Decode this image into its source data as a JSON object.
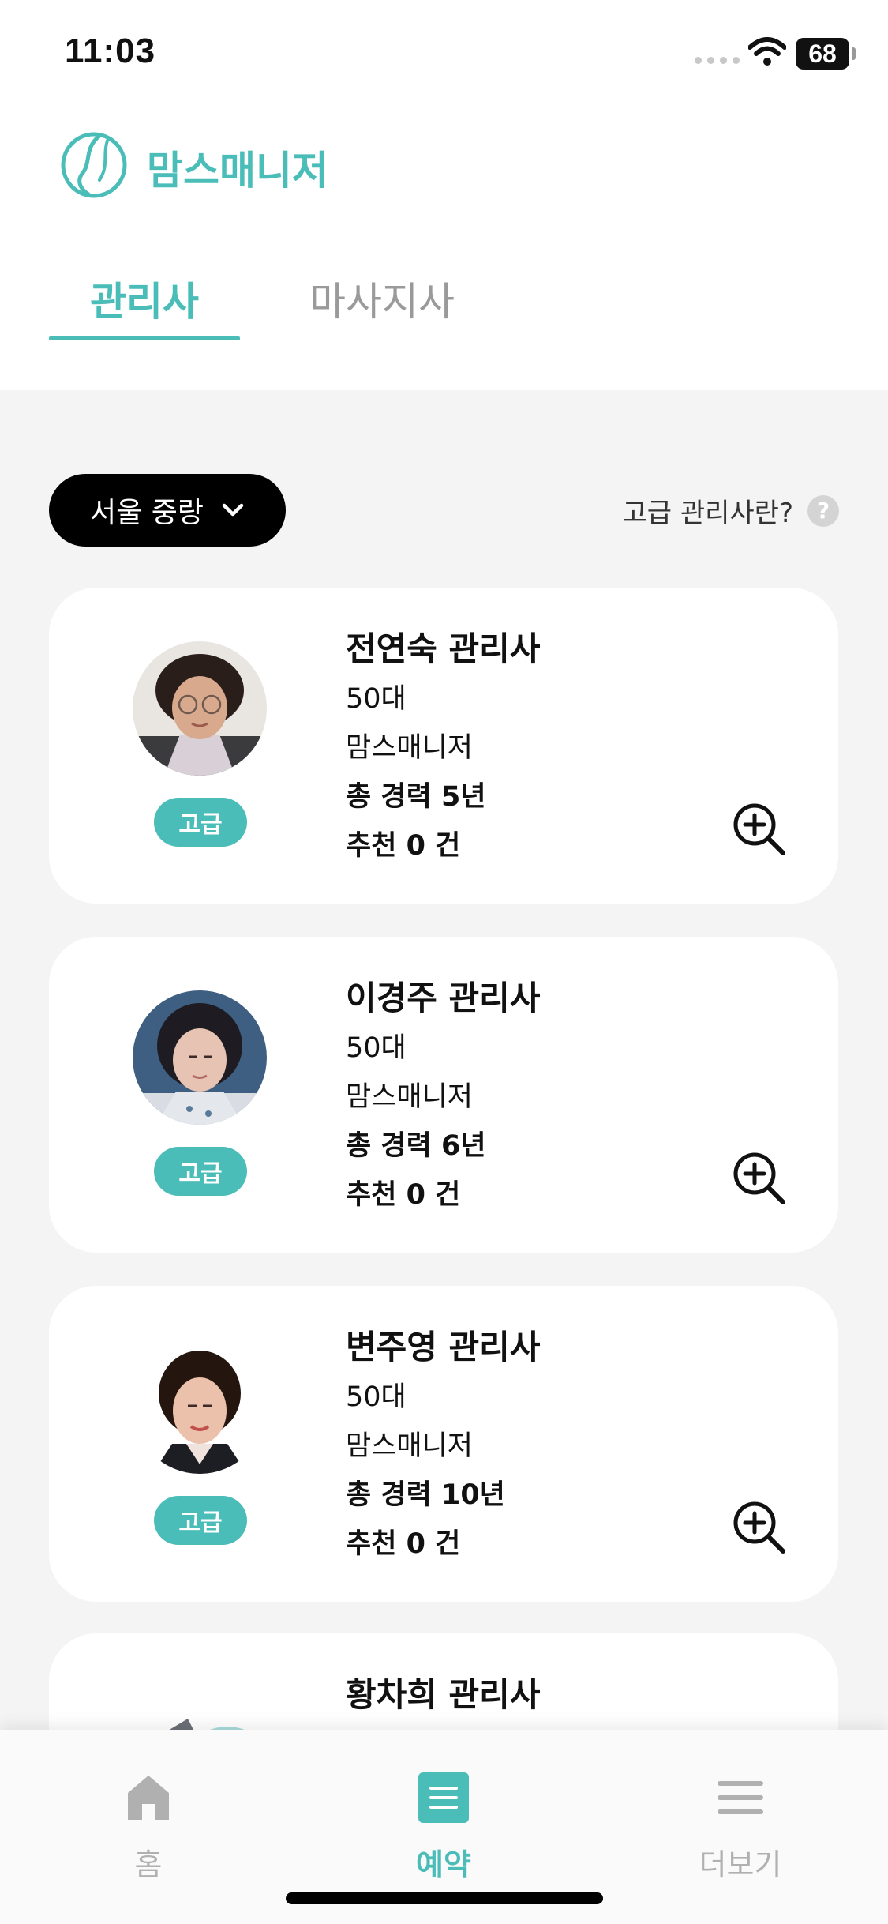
{
  "status_bar": {
    "time": "11:03",
    "battery": "68"
  },
  "app": {
    "name": "맘스매니저"
  },
  "tabs": [
    {
      "label": "관리사",
      "active": true
    },
    {
      "label": "마사지사",
      "active": false
    }
  ],
  "filter": {
    "region": "서울 중랑",
    "premium_question": "고급 관리사란?",
    "help_symbol": "?"
  },
  "caregivers": [
    {
      "name": "전연숙 관리사",
      "age": "50대",
      "company": "맘스매니저",
      "experience": "총 경력 5년",
      "recommendations": "추천 0 건",
      "grade": "고급"
    },
    {
      "name": "이경주 관리사",
      "age": "50대",
      "company": "맘스매니저",
      "experience": "총 경력 6년",
      "recommendations": "추천 0 건",
      "grade": "고급"
    },
    {
      "name": "변주영 관리사",
      "age": "50대",
      "company": "맘스매니저",
      "experience": "총 경력 10년",
      "recommendations": "추천 0 건",
      "grade": "고급"
    },
    {
      "name": "황차희 관리사"
    }
  ],
  "bottom_nav": [
    {
      "label": "홈",
      "icon": "home-icon",
      "active": false
    },
    {
      "label": "예약",
      "icon": "list-icon",
      "active": true
    },
    {
      "label": "더보기",
      "icon": "menu-icon",
      "active": false
    }
  ],
  "colors": {
    "accent": "#4bbdb8",
    "inactive": "#b0b0b0",
    "background": "#f4f4f4"
  }
}
